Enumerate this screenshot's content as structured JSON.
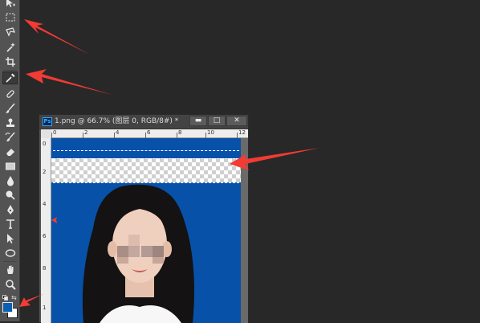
{
  "toolbar": {
    "tools": [
      "move-tool",
      "marquee-tool",
      "lasso-tool",
      "magic-wand-tool",
      "crop-tool",
      "eyedropper-tool",
      "healing-brush-tool",
      "brush-tool",
      "clone-stamp-tool",
      "history-brush-tool",
      "eraser-tool",
      "gradient-tool",
      "blur-tool",
      "dodge-tool",
      "pen-tool",
      "type-tool",
      "path-selection-tool",
      "ellipse-tool",
      "hand-tool",
      "zoom-tool"
    ],
    "active_tool": "eyedropper-tool",
    "foreground_color": "#0b5fb3",
    "background_color": "#ffffff"
  },
  "document": {
    "title": "1.png @ 66.7% (图层 0, RGB/8#) *",
    "ps_icon_label": "Ps",
    "minimize_label": "▬",
    "restore_label": "□",
    "close_label": "✕",
    "ruler_top_labels": [
      "0",
      "2",
      "4",
      "6",
      "8",
      "10",
      "12"
    ],
    "ruler_left_labels": [
      "0",
      "2",
      "4",
      "6",
      "8",
      "1"
    ],
    "canvas_background": "#0751a8"
  },
  "colors": {
    "workspace": "#282828",
    "panel": "#535353",
    "annotation_arrow": "#f23b33"
  }
}
